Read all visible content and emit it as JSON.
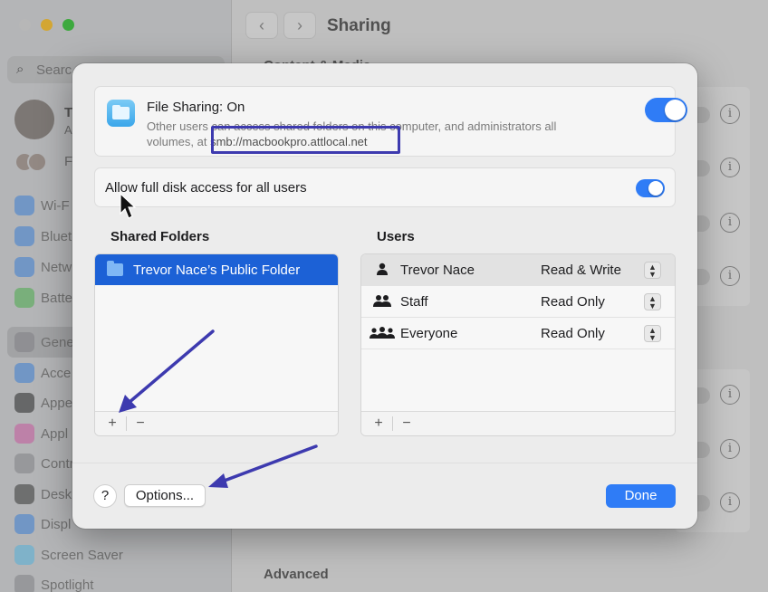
{
  "background": {
    "search_placeholder": "Searc",
    "account_initial": "T",
    "account_sub": "A",
    "family_label": "Fa",
    "sidebar_items": [
      "Wi-F",
      "Blueto",
      "Netw",
      "Batte",
      "Gene",
      "Acce",
      "Appe",
      "Appl",
      "Contr",
      "Desk",
      "Displ",
      "Screen Saver",
      "Spotlight"
    ],
    "window_title": "Sharing",
    "section_top": "Content & Media",
    "section_bottom": "Advanced",
    "info_glyph": "i"
  },
  "dialog": {
    "file_sharing": {
      "title": "File Sharing: On",
      "desc_line1": "Other users can access shared folders on this computer, and administrators all",
      "desc_line2_prefix": "volumes, at ",
      "url": "smb://macbookpro.attlocal.net",
      "toggle_on": true
    },
    "full_disk_access": {
      "label": "Allow full disk access for all users",
      "toggle_on": true
    },
    "shared_folders": {
      "header": "Shared Folders",
      "items": [
        {
          "name": "Trevor Nace’s Public Folder",
          "selected": true
        }
      ],
      "add_label": "+",
      "remove_label": "−"
    },
    "users": {
      "header": "Users",
      "rows": [
        {
          "name": "Trevor Nace",
          "permission": "Read & Write",
          "icon": "person-icon"
        },
        {
          "name": "Staff",
          "permission": "Read Only",
          "icon": "group-icon"
        },
        {
          "name": "Everyone",
          "permission": "Read Only",
          "icon": "everyone-icon"
        }
      ],
      "add_label": "+",
      "remove_label": "−"
    },
    "help_label": "?",
    "options_label": "Options...",
    "done_label": "Done"
  },
  "colors": {
    "accent": "#2f7cf6",
    "selection": "#1c61d6",
    "annotation": "#3d3aaf"
  }
}
